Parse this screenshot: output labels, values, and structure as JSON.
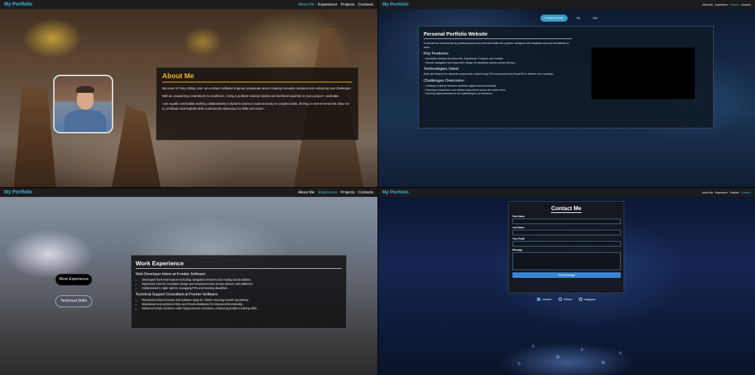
{
  "brand": "My Portfolio",
  "nav": [
    "About Me",
    "Experience",
    "Projects",
    "Contacts"
  ],
  "about": {
    "title": "About Me",
    "p1": "My name is Finley Gilday, and I am a driven Software Engineer passionate about creating innovative solutions and embracing new challenges.",
    "p2": "With an unwavering commitment to excellence, I bring a problem-solving mindset and technical expertise to every project I undertake.",
    "p3": "I am equally comfortable working collaboratively in dynamic teams or autonomously on complex tasks, thriving in environments that allow me to contribute meaningfully while continuously advancing my skills and career."
  },
  "projects": {
    "tabs": [
      "Portfolio Website",
      "Trip",
      "Nav"
    ],
    "title": "Personal Portfolio Website",
    "intro": "A central hub showcasing my professional journey, technical skills and projects, designed with simplicity and user-friendliness in mind.",
    "features_title": "Key Features:",
    "features": [
      "- Interactive sections for About Me, Experience, Projects, and Contact.",
      "- Smooth navigation and responsive design for seamless access across devices."
    ],
    "tech_title": "Technologies Used:",
    "tech": "Built with React js for dynamic components, styled using CSS and powered by EmailJS for efficient form handling.",
    "challenges_title": "Challenges Overcome:",
    "challenges": [
      "- Creating a balance between aesthetic appeal and functionality.",
      "- Ensuring a responsive and intuitive experience across all screen sizes.",
      "- Securing data submissions and optimizing for performance."
    ]
  },
  "experience": {
    "btn_work": "Work Experience",
    "btn_skills": "Technical Skills",
    "title": "Work Experience",
    "job1": "Web Developer Intern at Frontier Software:",
    "job1_items": [
      "Developed front-end features including navigation elements and routing functionalities.",
      "Optimized CSS for consistent design and responsiveness across devices and platforms.",
      "Collaborated in Agile sprints, managing PRs and meeting deadlines."
    ],
    "job2": "Technical Support Consultant at Frontier Software:",
    "job2_items": [
      "Resolved technical issues and software bugs for clients ensuring smooth operations.",
      "Maintained and optimized SQL and Oracle databases for improved functionality.",
      "Delivered timely solutions under high-pressure scenarios, enhancing problem-solving skills."
    ]
  },
  "contact": {
    "title": "Contact Me",
    "first": "First Name",
    "last": "Last Name",
    "email": "Your Email",
    "message": "Message",
    "send": "Send Message",
    "socials": [
      "LinkedIn",
      "GitHub",
      "Instagram"
    ]
  },
  "colors": {
    "accent": "#3fb6e0",
    "about_title": "#f0b429",
    "send": "#3a86d4"
  },
  "icons": [
    "linkedin-icon",
    "github-icon",
    "instagram-icon"
  ]
}
